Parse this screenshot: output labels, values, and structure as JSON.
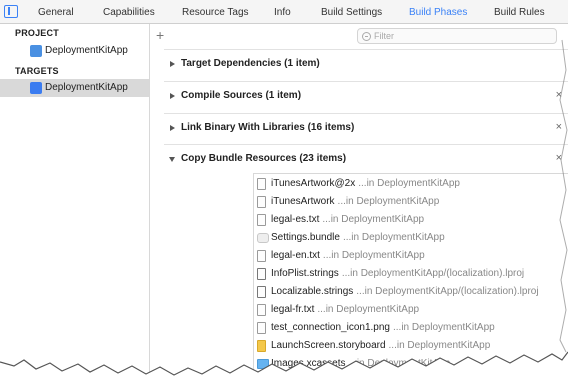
{
  "tabs": {
    "items": [
      {
        "label": "General"
      },
      {
        "label": "Capabilities"
      },
      {
        "label": "Resource Tags"
      },
      {
        "label": "Info"
      },
      {
        "label": "Build Settings"
      },
      {
        "label": "Build Phases"
      },
      {
        "label": "Build Rules"
      }
    ],
    "active_index": 5,
    "active_color": "#3b82f6"
  },
  "sidebar": {
    "project_header": "PROJECT",
    "project_item": {
      "label": "DeploymentKitApp",
      "icon": "xcode-project-icon"
    },
    "targets_header": "TARGETS",
    "target_item": {
      "label": "DeploymentKitApp",
      "icon": "app-target-icon",
      "selected": true
    }
  },
  "toolbar": {
    "add_label": "+",
    "filter_placeholder": "Filter"
  },
  "phases": [
    {
      "title": "Target Dependencies (1 item)",
      "expanded": false,
      "removable": false
    },
    {
      "title": "Compile Sources (1 item)",
      "expanded": false,
      "removable": true,
      "close": "×"
    },
    {
      "title": "Link Binary With Libraries (16 items)",
      "expanded": false,
      "removable": true,
      "close": "×"
    },
    {
      "title": "Copy Bundle Resources (23 items)",
      "expanded": true,
      "removable": true,
      "close": "×"
    }
  ],
  "files": [
    {
      "name": "iTunesArtwork@2x",
      "location": "...in DeploymentKitApp",
      "icon": "file-icon"
    },
    {
      "name": "iTunesArtwork",
      "location": "...in DeploymentKitApp",
      "icon": "file-icon"
    },
    {
      "name": "legal-es.txt",
      "location": "...in DeploymentKitApp",
      "icon": "file-icon"
    },
    {
      "name": "Settings.bundle",
      "location": "...in DeploymentKitApp",
      "icon": "bundle-icon"
    },
    {
      "name": "legal-en.txt",
      "location": "...in DeploymentKitApp",
      "icon": "file-icon"
    },
    {
      "name": "InfoPlist.strings",
      "location": "...in DeploymentKitApp/(localization).lproj",
      "icon": "strings-icon"
    },
    {
      "name": "Localizable.strings",
      "location": "...in DeploymentKitApp/(localization).lproj",
      "icon": "strings-icon"
    },
    {
      "name": "legal-fr.txt",
      "location": "...in DeploymentKitApp",
      "icon": "file-icon"
    },
    {
      "name": "test_connection_icon1.png",
      "location": "...in DeploymentKitApp",
      "icon": "file-icon"
    },
    {
      "name": "LaunchScreen.storyboard",
      "location": "...in DeploymentKitApp",
      "icon": "storyboard-icon"
    },
    {
      "name": "Images.xcassets",
      "location": "...in DeploymentKitApp",
      "icon": "asset-catalog-icon"
    }
  ]
}
